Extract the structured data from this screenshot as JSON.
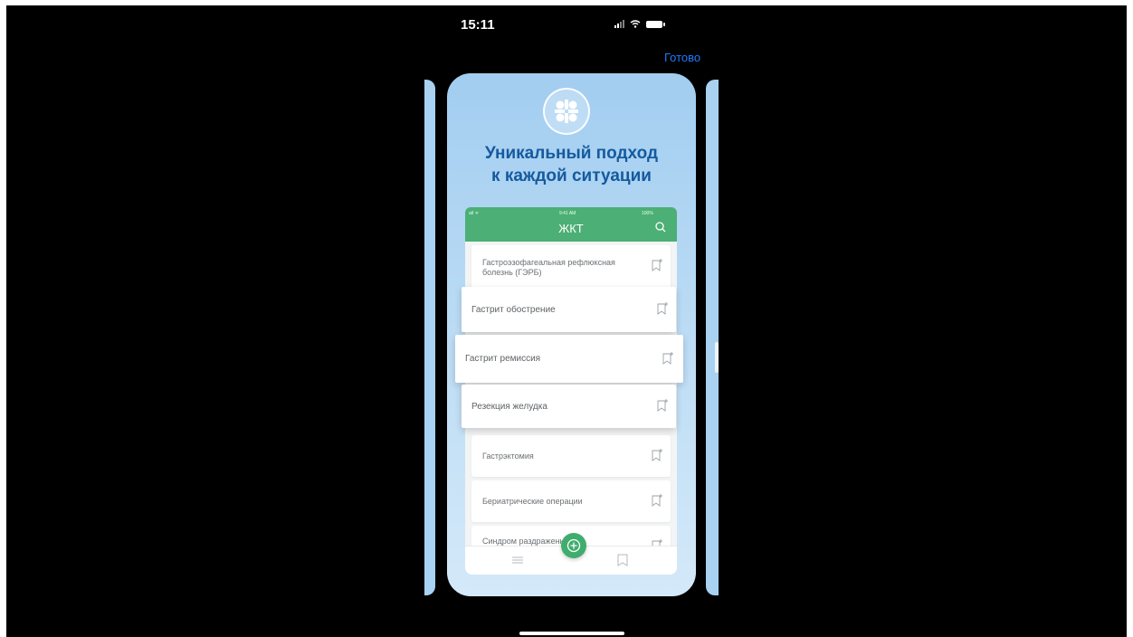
{
  "status_bar": {
    "time": "15:11"
  },
  "nav": {
    "done_label": "Готово"
  },
  "promo": {
    "headline_line1": "Уникальный подход",
    "headline_line2": "к каждой ситуации"
  },
  "inner_app": {
    "status_left": "atl ᯤ",
    "status_time": "9:41 AM",
    "status_right": "100%",
    "title": "ЖКТ",
    "list_items": [
      {
        "line1": "Гастроэзофагеальная рефлюксная",
        "line2": "болезнь (ГЭРБ)"
      },
      {
        "label": "Гастрэктомия"
      },
      {
        "label": "Бериатрические операции"
      },
      {
        "label": "Синдром раздраженного"
      }
    ],
    "popped_items": [
      {
        "label": "Гастрит обострение"
      },
      {
        "label": "Гастрит ремиссия"
      },
      {
        "label": "Резекция желудка"
      }
    ]
  },
  "colors": {
    "accent_blue": "#1e7bff",
    "header_green": "#4caf75",
    "headline_blue": "#155a9e",
    "card_gradient_top": "#a2cdf0"
  },
  "icons": [
    "logo-icon",
    "search-icon",
    "bookmark-icon",
    "menu-icon",
    "plus-circle-icon",
    "signal-icon",
    "wifi-icon",
    "battery-icon"
  ]
}
